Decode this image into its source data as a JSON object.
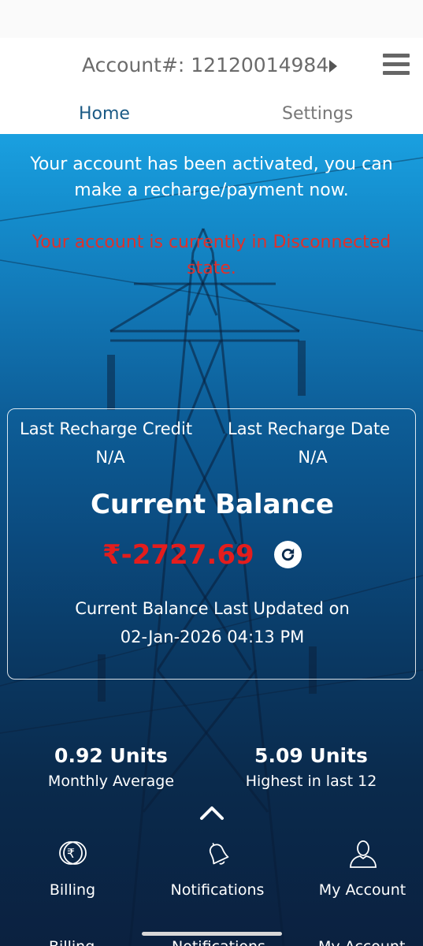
{
  "header": {
    "account_label": "Account#: 12120014984",
    "tabs": [
      {
        "label": "Home",
        "active": true
      },
      {
        "label": "Settings",
        "active": false
      }
    ]
  },
  "messages": {
    "activated": "Your account has been activated, you can make a recharge/payment now.",
    "disconnected": "Your account is currently in Disconnected state."
  },
  "balance_card": {
    "last_recharge_credit_label": "Last Recharge Credit",
    "last_recharge_credit_value": "N/A",
    "last_recharge_date_label": "Last Recharge Date",
    "last_recharge_date_value": "N/A",
    "current_balance_title": "Current Balance",
    "current_balance_amount": "₹-2727.69",
    "last_updated_label": "Current Balance Last Updated on",
    "last_updated_value": "02-Jan-2026 04:13 PM"
  },
  "stats": [
    {
      "value": "0.92 Units",
      "label": "Monthly Average"
    },
    {
      "value": "5.09 Units",
      "label": "Highest in last 12"
    }
  ],
  "bottom_nav": [
    {
      "label": "Billing",
      "icon": "rupee-coin-icon"
    },
    {
      "label": "Notifications",
      "icon": "bell-icon"
    },
    {
      "label": "My Account",
      "icon": "user-icon"
    }
  ],
  "peek_nav": [
    "Billing",
    "Notifications",
    "My Account"
  ],
  "colors": {
    "tab_active": "#1b5a85",
    "alert_red": "#e0302a",
    "balance_red": "#e41d1d",
    "hero_top": "#1aa0e0",
    "hero_bottom": "#0b2140"
  }
}
